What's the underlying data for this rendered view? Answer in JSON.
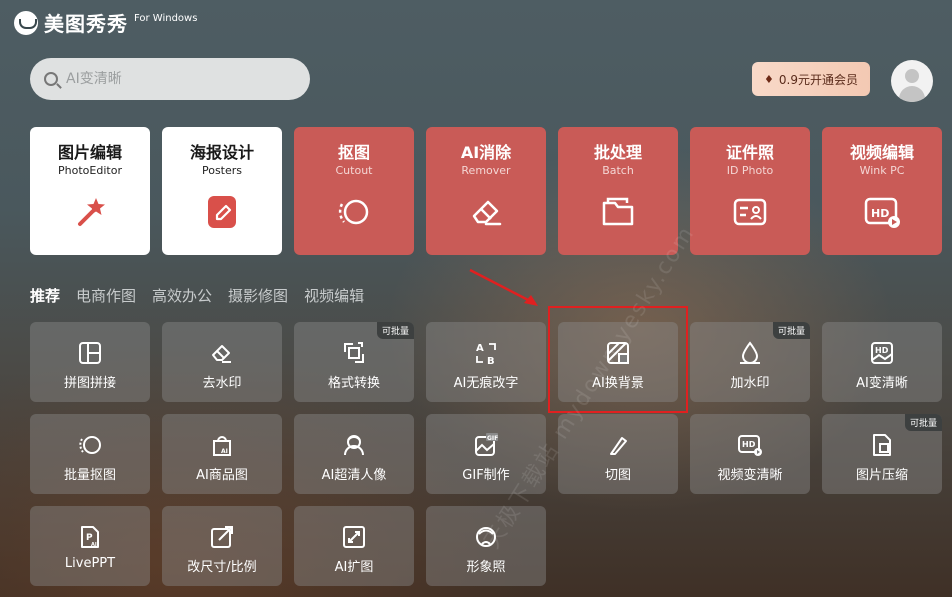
{
  "app": {
    "title": "美图秀秀",
    "subtitle": "For Windows"
  },
  "search": {
    "placeholder": "AI变清晰"
  },
  "vip": {
    "label": "0.9元开通会员",
    "icon": "diamond-icon"
  },
  "main_cards": [
    {
      "title": "图片编辑",
      "subtitle": "PhotoEditor",
      "icon": "magic-wand-icon",
      "style": "white"
    },
    {
      "title": "海报设计",
      "subtitle": "Posters",
      "icon": "pencil-icon",
      "style": "white"
    },
    {
      "title": "抠图",
      "subtitle": "Cutout",
      "icon": "cutout-icon",
      "style": "red"
    },
    {
      "title": "AI消除",
      "subtitle": "Remover",
      "icon": "eraser-icon",
      "style": "red"
    },
    {
      "title": "批处理",
      "subtitle": "Batch",
      "icon": "folder-icon",
      "style": "red"
    },
    {
      "title": "证件照",
      "subtitle": "ID Photo",
      "icon": "id-card-icon",
      "style": "red"
    },
    {
      "title": "视频编辑",
      "subtitle": "Wink PC",
      "icon": "hd-video-icon",
      "style": "red"
    }
  ],
  "tabs": [
    "推荐",
    "电商作图",
    "高效办公",
    "摄影修图",
    "视频编辑"
  ],
  "active_tab": "推荐",
  "tools": [
    {
      "label": "拼图拼接",
      "icon": "collage-icon"
    },
    {
      "label": "去水印",
      "icon": "eraser-icon"
    },
    {
      "label": "格式转换",
      "icon": "format-convert-icon",
      "badge": "可批量"
    },
    {
      "label": "AI无痕改字",
      "icon": "ab-text-icon"
    },
    {
      "label": "AI换背景",
      "icon": "background-swap-icon"
    },
    {
      "label": "加水印",
      "icon": "watermark-drop-icon",
      "badge": "可批量"
    },
    {
      "label": "AI变清晰",
      "icon": "hd-image-icon"
    },
    {
      "label": "批量抠图",
      "icon": "batch-cutout-icon"
    },
    {
      "label": "AI商品图",
      "icon": "product-bag-icon"
    },
    {
      "label": "AI超清人像",
      "icon": "portrait-icon"
    },
    {
      "label": "GIF制作",
      "icon": "gif-icon"
    },
    {
      "label": "切图",
      "icon": "knife-icon"
    },
    {
      "label": "视频变清晰",
      "icon": "hd-video-icon"
    },
    {
      "label": "图片压缩",
      "icon": "compress-icon",
      "badge": "可批量"
    },
    {
      "label": "LivePPT",
      "icon": "ppt-icon"
    },
    {
      "label": "改尺寸/比例",
      "icon": "resize-icon"
    },
    {
      "label": "AI扩图",
      "icon": "expand-image-icon"
    },
    {
      "label": "形象照",
      "icon": "avatar-photo-icon"
    }
  ],
  "watermark_text": "天极下载站 mydown.yesky.com"
}
